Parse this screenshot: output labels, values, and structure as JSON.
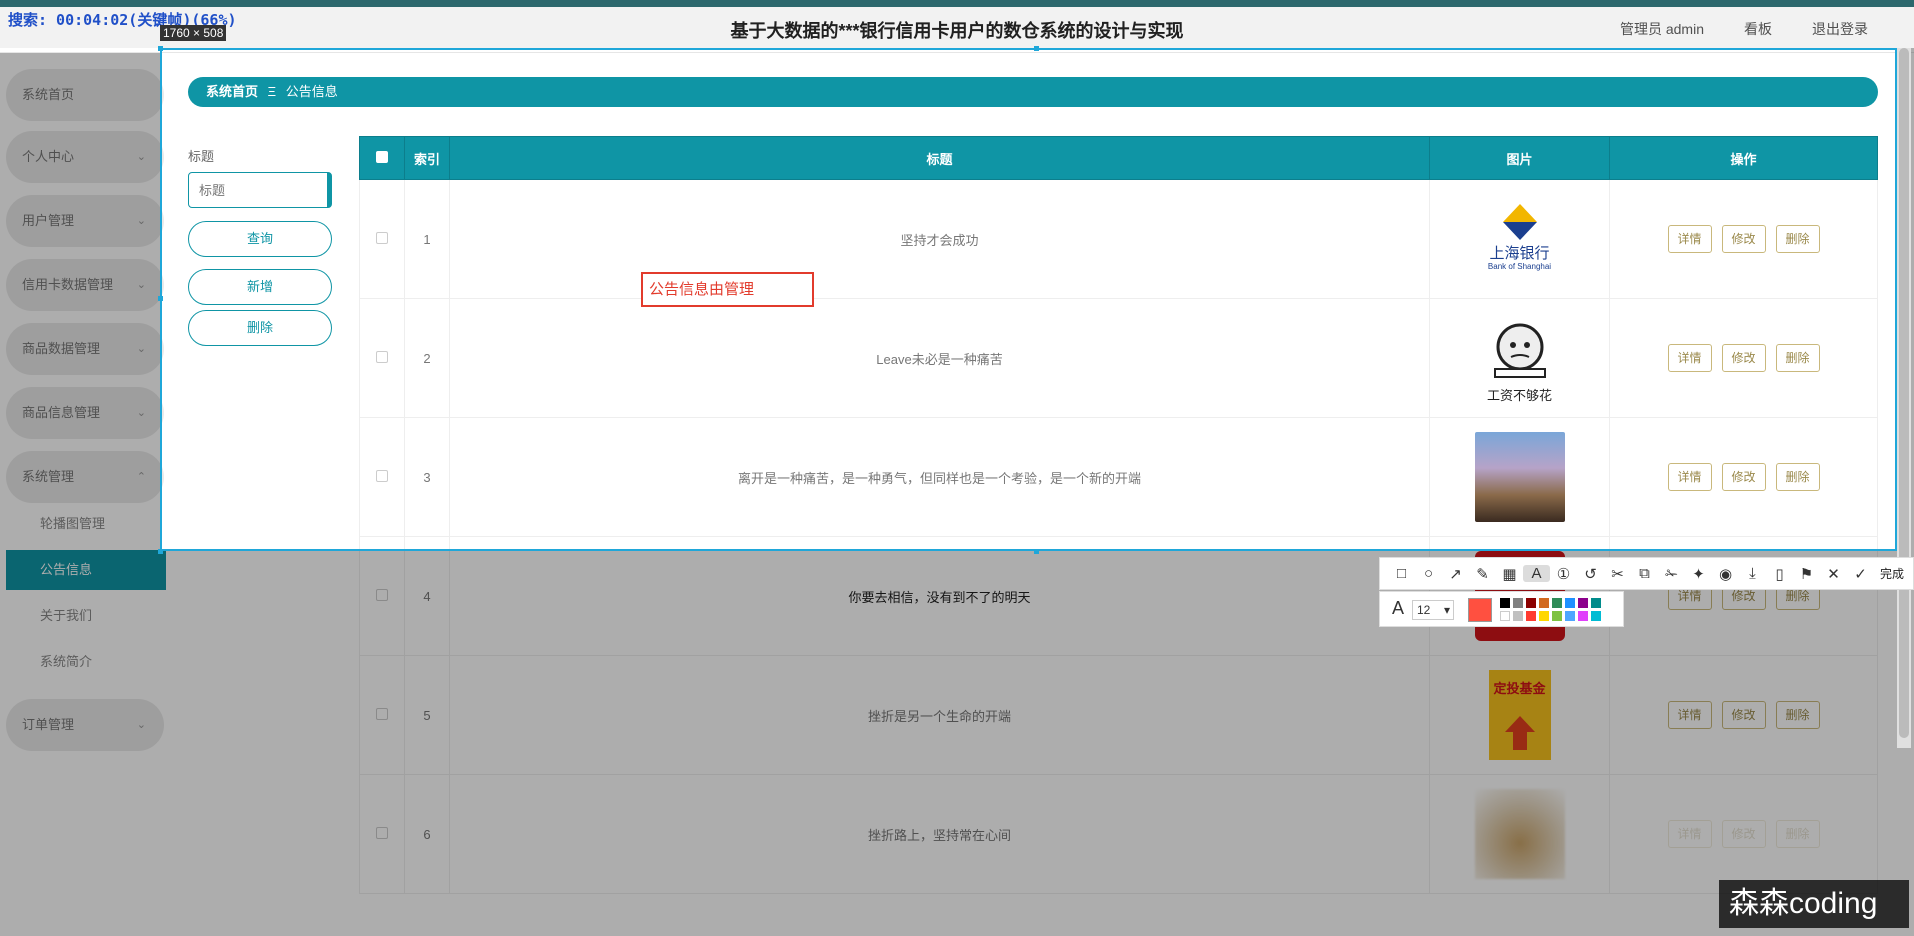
{
  "recorder": {
    "status": "搜索: 00:04:02(关键帧)(66%)",
    "selection_size": "1760 × 508"
  },
  "header": {
    "title": "基于大数据的***银行信用卡用户的数仓系统的设计与实现",
    "admin": "管理员 admin",
    "board": "看板",
    "logout": "退出登录"
  },
  "sidebar": {
    "items": [
      {
        "label": "系统首页",
        "chevron": false
      },
      {
        "label": "个人中心",
        "chevron": true
      },
      {
        "label": "用户管理",
        "chevron": true
      },
      {
        "label": "信用卡数据管理",
        "chevron": true
      },
      {
        "label": "商品数据管理",
        "chevron": true
      },
      {
        "label": "商品信息管理",
        "chevron": true
      },
      {
        "label": "系统管理",
        "chevron": true
      },
      {
        "label": "订单管理",
        "chevron": true
      }
    ],
    "sub_items": [
      "轮播图管理",
      "公告信息",
      "关于我们",
      "系统简介"
    ],
    "active_sub": "公告信息"
  },
  "breadcrumb": {
    "home": "系统首页",
    "sep": "Ξ",
    "current": "公告信息"
  },
  "search": {
    "label": "标题",
    "placeholder": "标题",
    "query_btn": "查询",
    "add_btn": "新增",
    "delete_btn": "删除"
  },
  "table": {
    "headers": [
      "索引",
      "标题",
      "图片",
      "操作"
    ],
    "actions": [
      "详情",
      "修改",
      "删除"
    ],
    "rows": [
      {
        "index": "1",
        "title": "坚持才会成功",
        "image": "bank-of-shanghai-logo",
        "img_caption": "上海银行",
        "img_sub": "Bank of Shanghai"
      },
      {
        "index": "2",
        "title": "Leave未必是一种痛苦",
        "image": "meme-face-image",
        "img_caption": "工资不够花"
      },
      {
        "index": "3",
        "title": "离开是一种痛苦，是一种勇气，但同样也是一个考验，是一个新的开端",
        "image": "coins-photo"
      },
      {
        "index": "4",
        "title": "你要去相信，没有到不了的明天",
        "image": "red-banner-image"
      },
      {
        "index": "5",
        "title": "挫折是另一个生命的开端",
        "image": "fund-poster-image",
        "img_caption": "定投基金"
      },
      {
        "index": "6",
        "title": "挫折路上，坚持常在心间",
        "image": "plant-photo"
      }
    ]
  },
  "annotation": {
    "text": "公告信息由管理"
  },
  "toolbar": {
    "done_label": "完成",
    "font_size": "12",
    "colors": [
      "#000000",
      "#808080",
      "#8b0000",
      "#d2691e",
      "#2e8b57",
      "#1e90ff",
      "#8b008b",
      "#008b8b",
      "#ffffff",
      "#c0c0c0",
      "#ff3b30",
      "#ffd700",
      "#7fc241",
      "#4da6ff",
      "#e040fb",
      "#00bcd4"
    ],
    "current_color": "#ff5040"
  },
  "watermark": {
    "text": "森森coding"
  }
}
